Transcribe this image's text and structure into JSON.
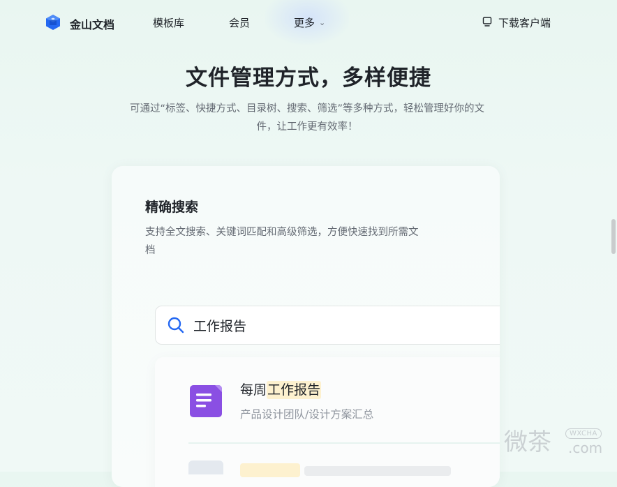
{
  "nav": {
    "logo_text": "金山文档",
    "links": [
      "模板库",
      "会员",
      "更多"
    ],
    "download_label": "下载客户端"
  },
  "hero": {
    "headline": "文件管理方式，多样便捷",
    "subline": "可通过“标签、快捷方式、目录树、搜索、筛选”等多种方式，轻松管理好你的文件，让工作更有效率！"
  },
  "feature": {
    "title": "精确搜索",
    "description": "支持全文搜索、关键词匹配和高级筛选，方便快速找到所需文档"
  },
  "search": {
    "query": "工作报告"
  },
  "results": [
    {
      "title_prefix": "每周",
      "title_highlight": "工作报告",
      "path": "产品设计团队/设计方案汇总"
    }
  ],
  "watermark": {
    "main": "微茶",
    "badge": "WXCHA",
    "suffix": ".com"
  },
  "colors": {
    "brand_blue": "#2468f2",
    "doc_purple": "#8a4fe3",
    "highlight": "#fdf1cf"
  }
}
